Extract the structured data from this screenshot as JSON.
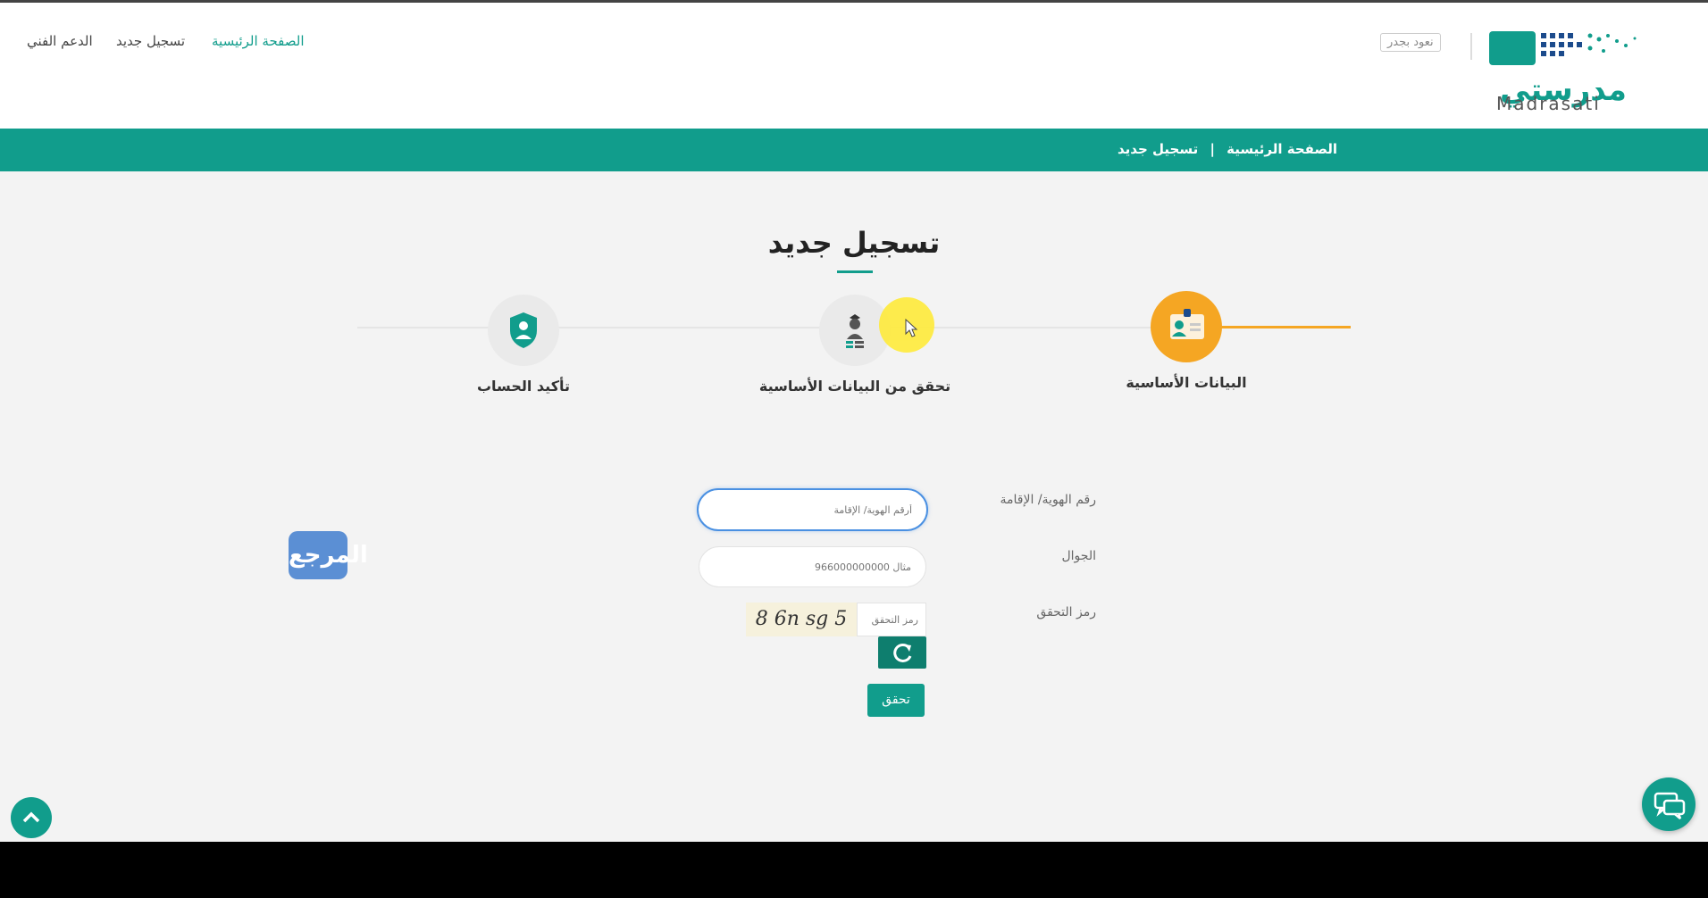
{
  "header": {
    "nav": [
      {
        "label": "الدعم الفني"
      },
      {
        "label": "تسجيل جديد"
      },
      {
        "label": "الصفحة الرئيسية"
      }
    ],
    "back_link": "نعود بجدر",
    "logo_text_ar": "مدرستي",
    "logo_text_en": "Madrasati"
  },
  "breadcrumb": {
    "home": "الصفحة الرئيسية",
    "separator": "|",
    "current": "تسجيل جديد"
  },
  "page_title": "تسجيل جديد",
  "steps": [
    {
      "label": "البيانات الأساسية"
    },
    {
      "label": "تحقق من البيانات الأساسية"
    },
    {
      "label": "تأكيد الحساب"
    }
  ],
  "form": {
    "id_label": "رقم الهوية/ الإقامة",
    "id_placeholder": "أرقم الهوية/ الإقامة",
    "mobile_label": "الجوال",
    "mobile_placeholder": "مثال 966000000000",
    "captcha_label": "رمز التحقق",
    "captcha_placeholder": "رمز التحقق",
    "captcha_text": "8 6n sg 5",
    "verify_label": "تحقق"
  },
  "watermark_text": "المرجع",
  "colors": {
    "primary": "#119d8c",
    "accent": "#f5a623"
  },
  "icons": [
    "shield-user-icon",
    "id-card-user-icon",
    "refresh-icon",
    "chevron-up-icon",
    "chat-icon",
    "cursor-icon"
  ]
}
